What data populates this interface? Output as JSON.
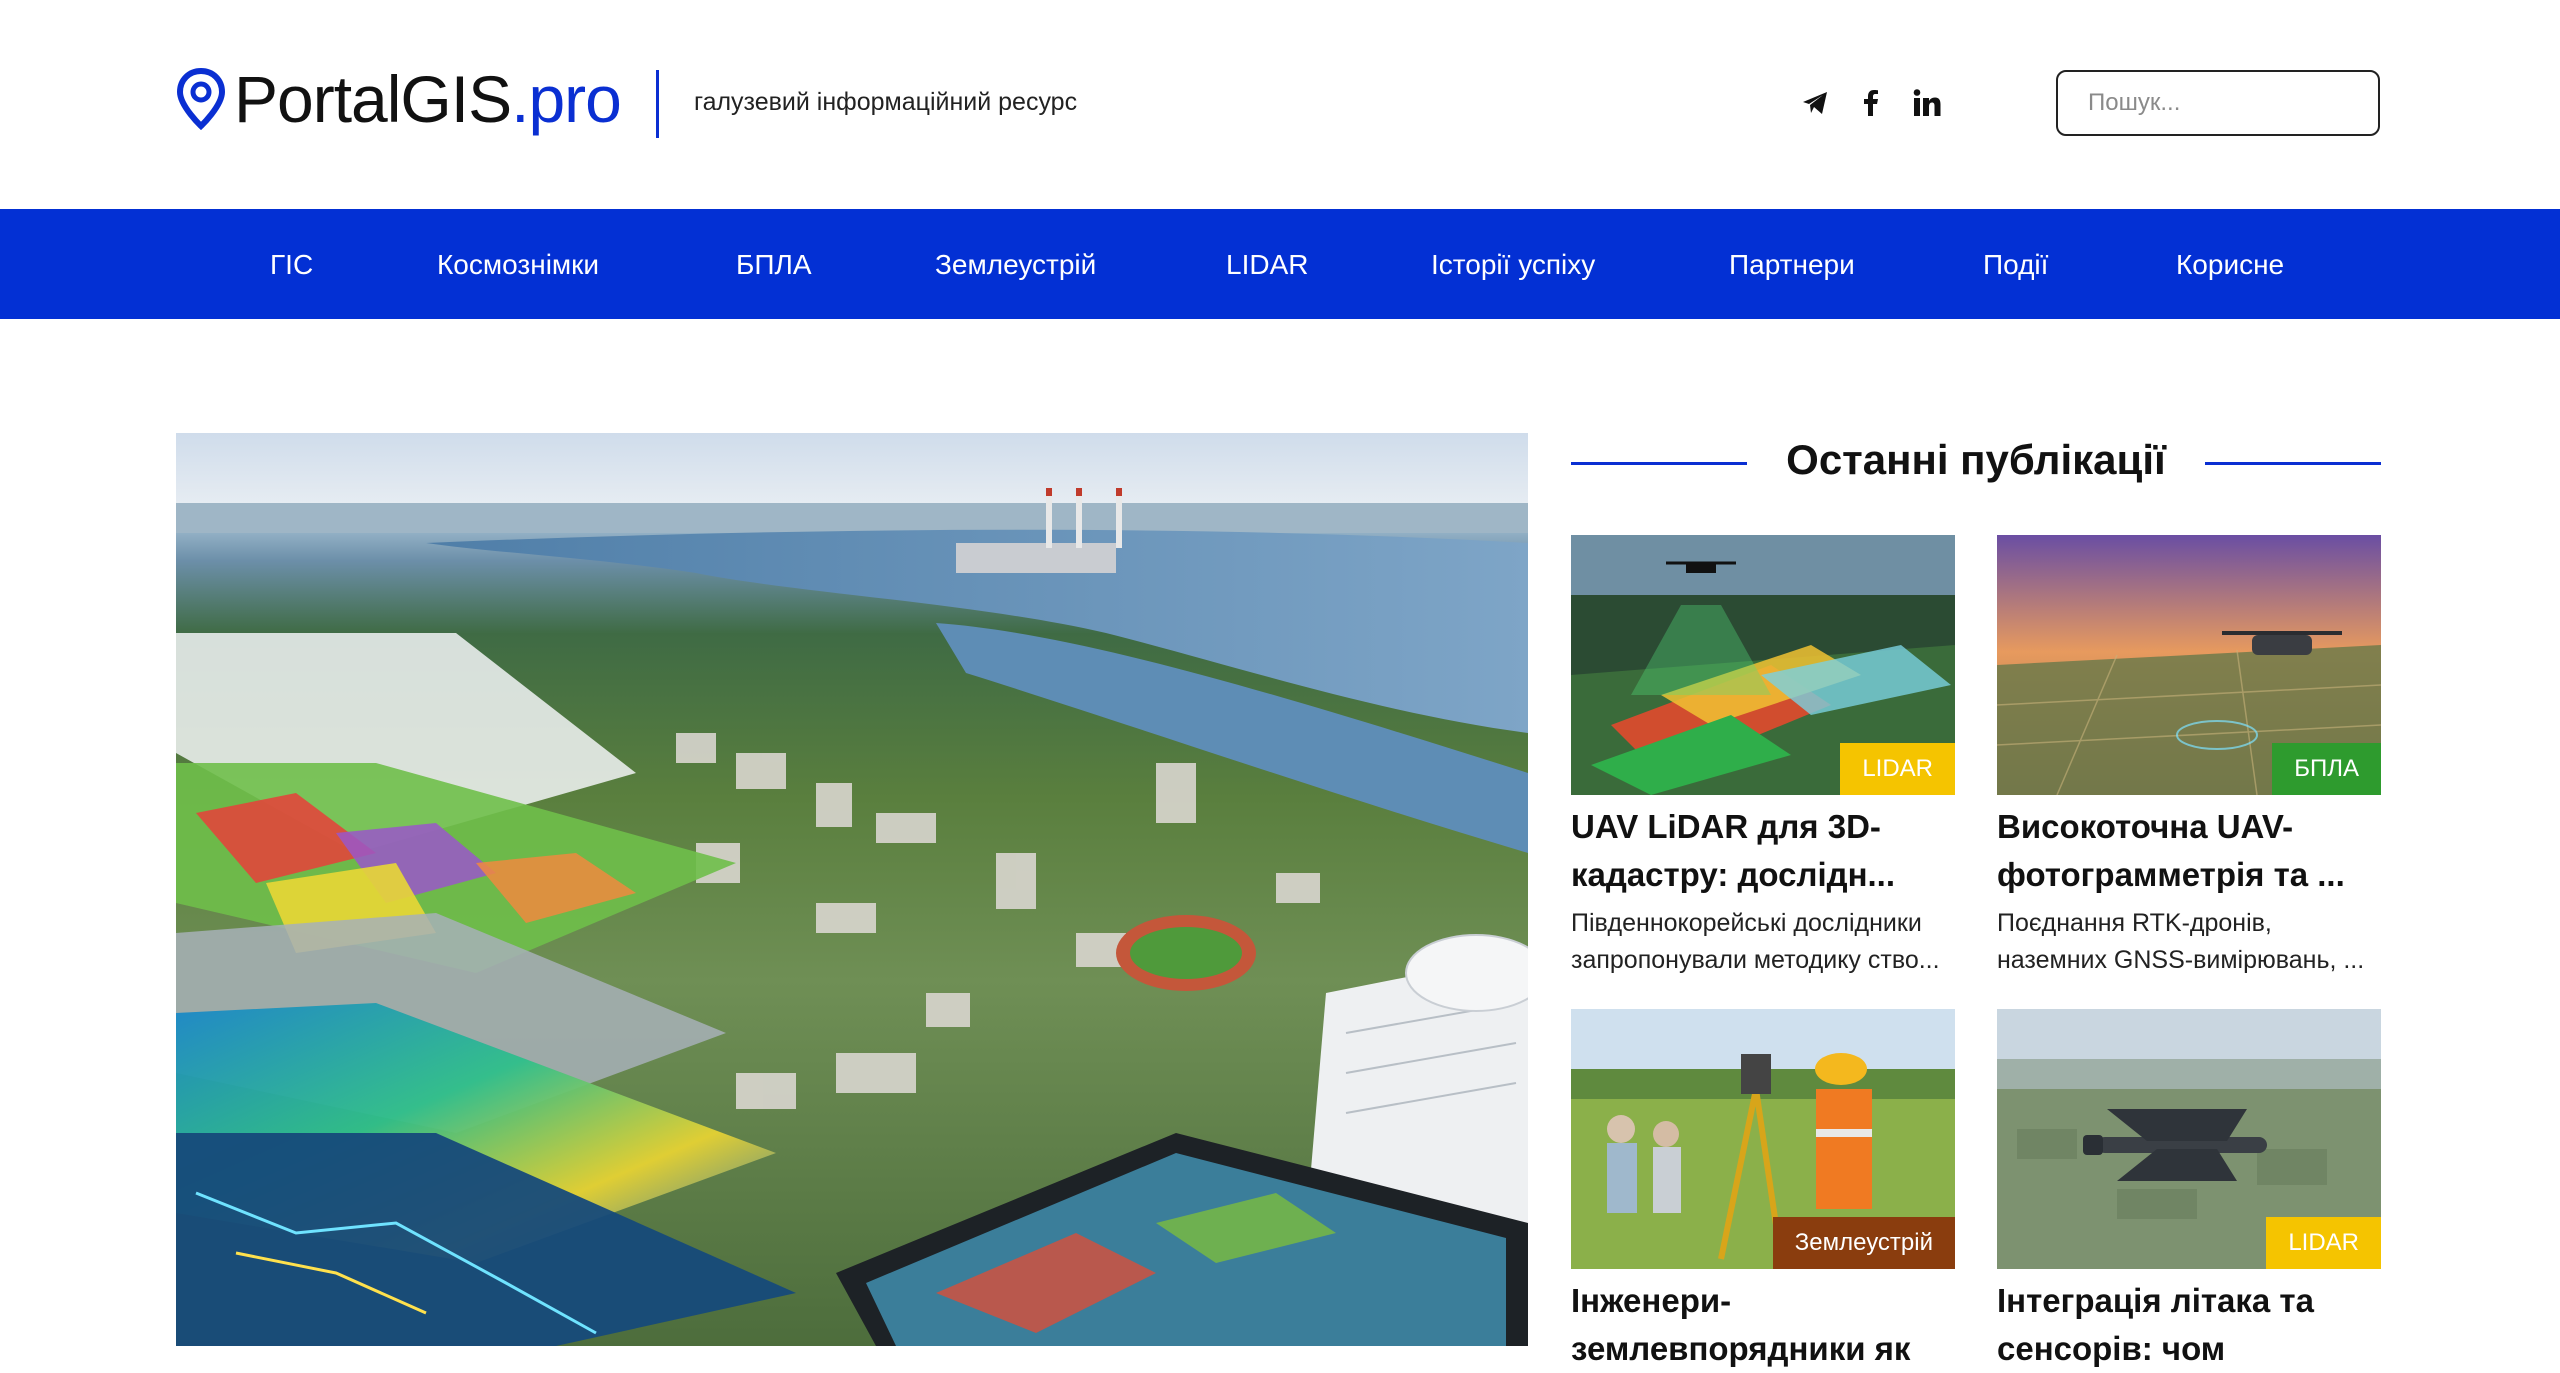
{
  "brand": {
    "name": "PortalGIS",
    "tld": ".pro",
    "tagline": "галузевий інформаційний ресурс",
    "accent_color": "#0330d4"
  },
  "socials": [
    {
      "icon": "telegram-icon"
    },
    {
      "icon": "facebook-icon"
    },
    {
      "icon": "linkedin-icon"
    }
  ],
  "search": {
    "placeholder": "Пошук..."
  },
  "nav": {
    "items": [
      {
        "label": "ГІС"
      },
      {
        "label": "Космознімки"
      },
      {
        "label": "БПЛА"
      },
      {
        "label": "Землеустрій"
      },
      {
        "label": "LIDAR"
      },
      {
        "label": "Історії успіху"
      },
      {
        "label": "Партнери"
      },
      {
        "label": "Події"
      },
      {
        "label": "Корисне"
      }
    ]
  },
  "sidebar": {
    "title": "Останні публікації",
    "cards": [
      {
        "badge": "LIDAR",
        "badge_color": "#f5c400",
        "title": "UAV LiDAR для 3D-кадастру: дослідн...",
        "desc": "Південнокорейські дослідники запропонували методику ство..."
      },
      {
        "badge": "БПЛА",
        "badge_color": "#2e9b2e",
        "title": "Високоточна UAV-фотограмметрія та ...",
        "desc": "Поєднання RTK-дронів, наземних GNSS-вимірювань, ..."
      },
      {
        "badge": "Землеустрій",
        "badge_color": "#8a3d0e",
        "title": "Інженери-землевпорядники як",
        "desc": ""
      },
      {
        "badge": "LIDAR",
        "badge_color": "#f5c400",
        "title": "Інтеграція літака та сенсорів: чом",
        "desc": ""
      }
    ]
  }
}
